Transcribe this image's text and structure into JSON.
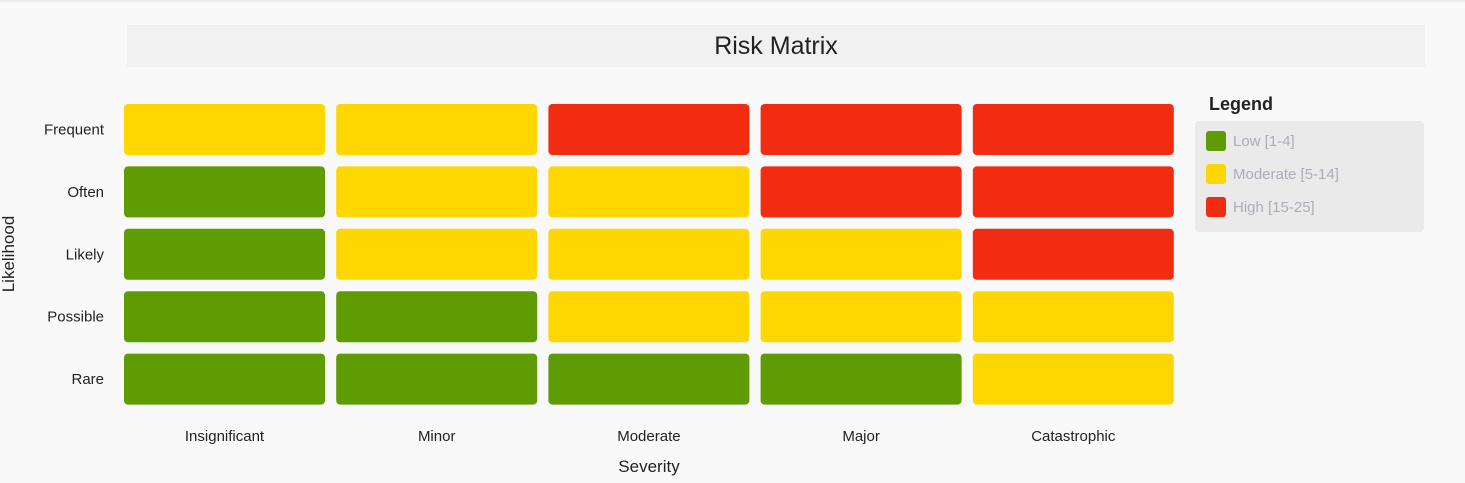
{
  "title": "Risk Matrix",
  "colors": {
    "low": "#5f9b03",
    "moderate": "#ffd700",
    "high": "#f22c10"
  },
  "legend": {
    "title": "Legend",
    "items": [
      {
        "label": "Low [1-4]",
        "level": "low"
      },
      {
        "label": "Moderate [5-14]",
        "level": "moderate"
      },
      {
        "label": "High [15-25]",
        "level": "high"
      }
    ]
  },
  "chart_data": {
    "type": "heatmap",
    "title": "Risk Matrix",
    "xlabel": "Severity",
    "ylabel": "Likelihood",
    "x_categories": [
      "Insignificant",
      "Minor",
      "Moderate",
      "Major",
      "Catastrophic"
    ],
    "y_categories": [
      "Frequent",
      "Often",
      "Likely",
      "Possible",
      "Rare"
    ],
    "cells": [
      [
        "moderate",
        "moderate",
        "high",
        "high",
        "high"
      ],
      [
        "low",
        "moderate",
        "moderate",
        "high",
        "high"
      ],
      [
        "low",
        "moderate",
        "moderate",
        "moderate",
        "high"
      ],
      [
        "low",
        "low",
        "moderate",
        "moderate",
        "moderate"
      ],
      [
        "low",
        "low",
        "low",
        "low",
        "moderate"
      ]
    ],
    "legend_position": "right"
  }
}
